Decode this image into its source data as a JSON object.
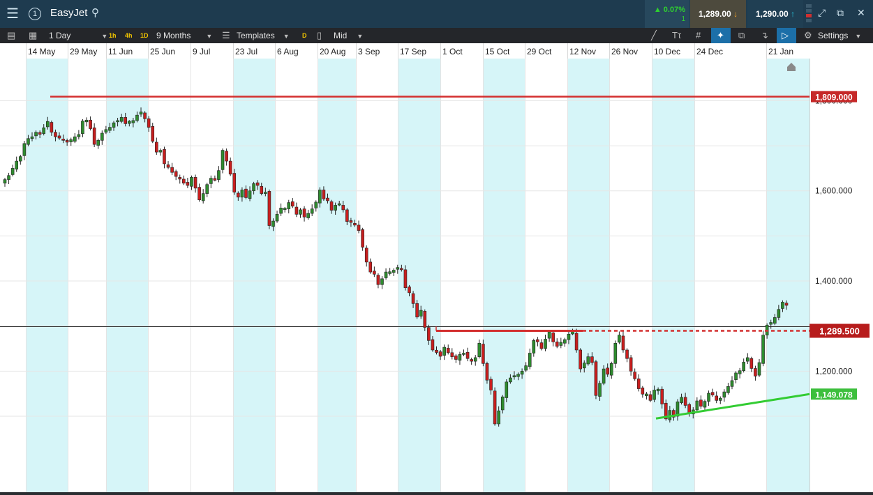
{
  "header": {
    "menu_icon": "hamburger-icon",
    "info_badge": "1",
    "title": "EasyJet",
    "search_icon": "search-icon",
    "change_pct": "0.07%",
    "change_count": "1",
    "sell_price": "1,289.00",
    "buy_price": "1,290.00",
    "icons": [
      "expand-icon",
      "popout-icon",
      "close-icon"
    ],
    "colors": {
      "up": "#2fd12f",
      "sell_arrow": "#f0a12b",
      "buy_arrow": "#27c7e0"
    }
  },
  "toolbar": {
    "interval": "1 Day",
    "quick_intervals": [
      "1h",
      "4h",
      "1D"
    ],
    "period": "9 Months",
    "templates": "Templates",
    "d_badge": "D",
    "price_type": "Mid",
    "settings": "Settings"
  },
  "chart_data": {
    "type": "candlestick",
    "title": "EasyJet",
    "x_tick_labels": [
      "14 May",
      "29 May",
      "11 Jun",
      "25 Jun",
      "9 Jul",
      "23 Jul",
      "6 Aug",
      "20 Aug",
      "3 Sep",
      "17 Sep",
      "1 Oct",
      "15 Oct",
      "29 Oct",
      "12 Nov",
      "26 Nov",
      "10 Dec",
      "24 Dec",
      "21 Jan"
    ],
    "y_tick_labels": [
      "1,800.000",
      "1,600.000",
      "1,400.000",
      "1,200.000"
    ],
    "ylim": [
      1031,
      1868
    ],
    "grid": true,
    "closes": [
      1625,
      1634,
      1650,
      1666,
      1676,
      1705,
      1716,
      1720,
      1730,
      1727,
      1740,
      1754,
      1730,
      1720,
      1717,
      1712,
      1708,
      1712,
      1720,
      1725,
      1755,
      1757,
      1738,
      1703,
      1712,
      1728,
      1736,
      1741,
      1751,
      1756,
      1763,
      1749,
      1753,
      1756,
      1768,
      1775,
      1760,
      1741,
      1710,
      1686,
      1690,
      1660,
      1652,
      1641,
      1632,
      1626,
      1617,
      1612,
      1630,
      1606,
      1580,
      1594,
      1614,
      1628,
      1625,
      1645,
      1690,
      1666,
      1637,
      1597,
      1586,
      1602,
      1585,
      1600,
      1616,
      1612,
      1594,
      1597,
      1523,
      1533,
      1548,
      1562,
      1560,
      1574,
      1566,
      1548,
      1558,
      1542,
      1550,
      1560,
      1575,
      1602,
      1582,
      1578,
      1557,
      1568,
      1570,
      1558,
      1532,
      1530,
      1524,
      1512,
      1475,
      1442,
      1420,
      1415,
      1392,
      1405,
      1420,
      1419,
      1424,
      1430,
      1425,
      1385,
      1374,
      1350,
      1320,
      1335,
      1297,
      1268,
      1247,
      1243,
      1233,
      1253,
      1241,
      1232,
      1226,
      1237,
      1240,
      1228,
      1222,
      1230,
      1262,
      1217,
      1180,
      1158,
      1083,
      1112,
      1143,
      1176,
      1185,
      1190,
      1193,
      1200,
      1212,
      1240,
      1268,
      1265,
      1250,
      1271,
      1287,
      1265,
      1255,
      1264,
      1270,
      1282,
      1286,
      1247,
      1205,
      1218,
      1232,
      1219,
      1146,
      1173,
      1205,
      1193,
      1217,
      1262,
      1280,
      1247,
      1228,
      1200,
      1183,
      1161,
      1149,
      1148,
      1135,
      1158,
      1160,
      1127,
      1094,
      1113,
      1098,
      1132,
      1142,
      1124,
      1107,
      1114,
      1134,
      1122,
      1133,
      1151,
      1147,
      1135,
      1140,
      1154,
      1166,
      1179,
      1196,
      1201,
      1220,
      1230,
      1206,
      1189,
      1219,
      1280,
      1302,
      1308,
      1319,
      1337,
      1353,
      1346
    ],
    "red_line_1": 1809.0,
    "red_line_2": 1289.5,
    "support_line": 1149.078,
    "support_line_start": 1095,
    "series": [
      {
        "name": "EasyJet",
        "values": []
      }
    ],
    "labels": {
      "high_line": "1,809.000",
      "current": "1,289.500",
      "support": "1,149.078"
    }
  }
}
